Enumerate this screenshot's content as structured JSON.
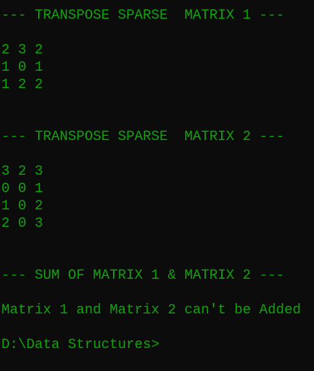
{
  "colors": {
    "background": "#0c0c0c",
    "text": "#13a10e"
  },
  "console": {
    "lines": [
      "--- TRANSPOSE SPARSE  MATRIX 1 ---",
      "",
      "2 3 2",
      "1 0 1",
      "1 2 2",
      "",
      "",
      "--- TRANSPOSE SPARSE  MATRIX 2 ---",
      "",
      "3 2 3",
      "0 0 1",
      "1 0 2",
      "2 0 3",
      "",
      "",
      "--- SUM OF MATRIX 1 & MATRIX 2 ---",
      "",
      "Matrix 1 and Matrix 2 can't be Added",
      "",
      "D:\\Data Structures>"
    ]
  }
}
